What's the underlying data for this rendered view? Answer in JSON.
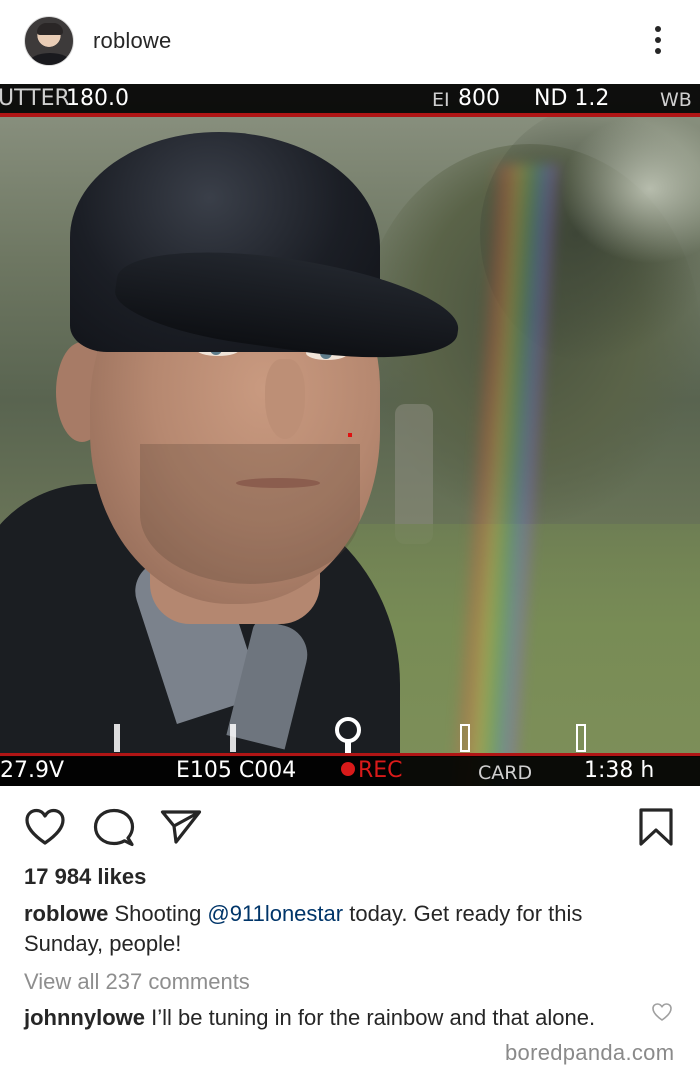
{
  "post": {
    "username": "roblowe",
    "likes": "17 984 likes",
    "caption": {
      "username": "roblowe",
      "text_before": " Shooting ",
      "mention": "@911lonestar",
      "text_after": " today. Get ready for this Sunday, people!"
    },
    "view_all_comments": "View all 237 comments",
    "comments": [
      {
        "username": "johnnylowe",
        "text": " I’ll be tuning in for the rainbow and that alone."
      }
    ]
  },
  "camera_hud": {
    "shutter_label": "UTTER",
    "shutter_value": "180.0",
    "ei_label": "EI",
    "ei_value": "800",
    "nd_value": "ND 1.2",
    "wb_label": "WB",
    "voltage": "27.9V",
    "clip_id": "E105 C004",
    "rec_label": "REC",
    "card_label": "CARD",
    "remaining": "1:38 h"
  },
  "icons": {
    "more": "more-vertical-icon",
    "like": "heart-icon",
    "comment": "comment-bubble-icon",
    "share": "paper-plane-icon",
    "save": "bookmark-icon"
  },
  "colors": {
    "text": "#262626",
    "mention": "#003569",
    "muted": "#8e8e8e",
    "hud_red": "#d91a1a"
  },
  "watermark": "boredpanda.com"
}
